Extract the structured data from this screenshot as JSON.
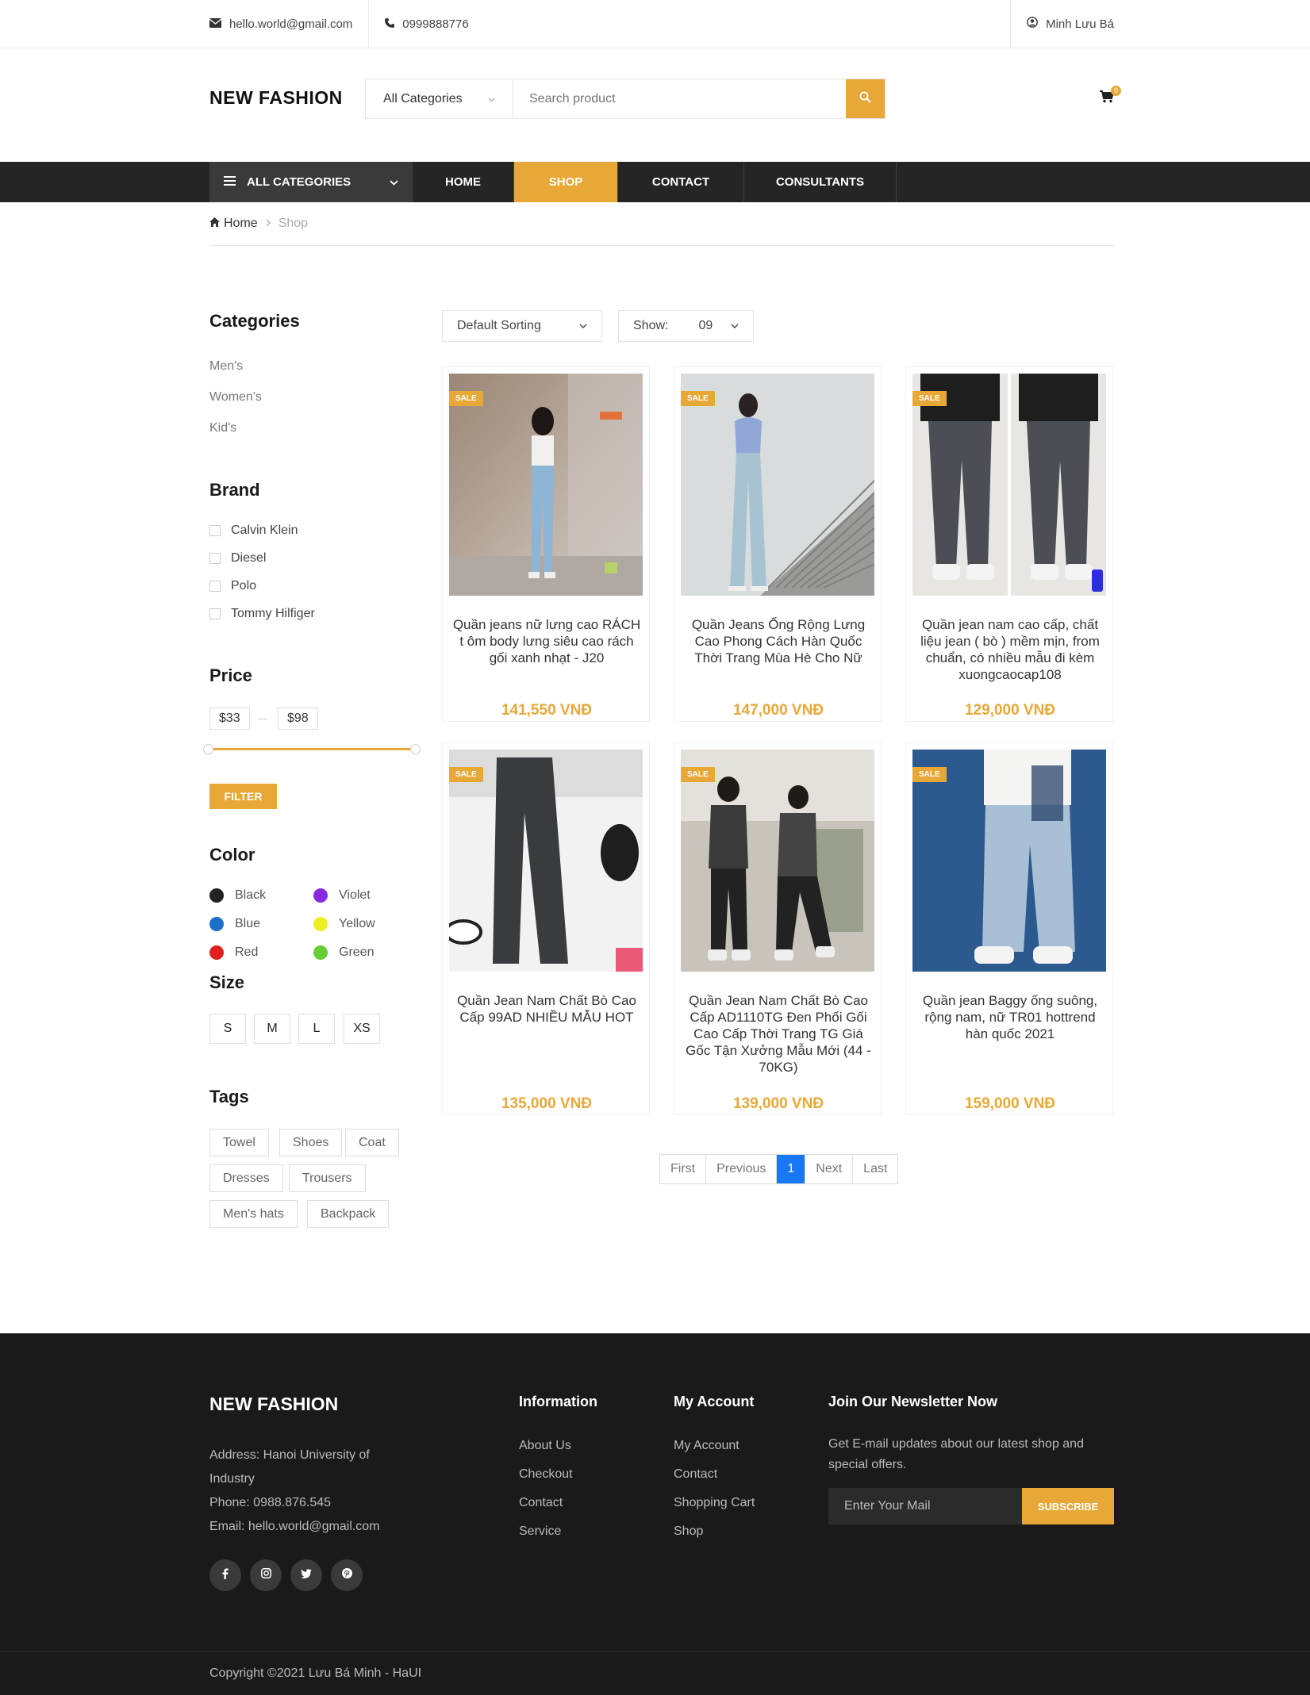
{
  "topbar": {
    "email": "hello.world@gmail.com",
    "phone": "0999888776",
    "user": "Minh Lưu Bá"
  },
  "header": {
    "logo": "NEW FASHION",
    "category_select": "All Categories",
    "search_placeholder": "Search product",
    "cart_count": "0"
  },
  "nav": {
    "all_categories": "ALL CATEGORIES",
    "items": [
      "HOME",
      "SHOP",
      "CONTACT",
      "CONSULTANTS"
    ],
    "active": "SHOP"
  },
  "breadcrumb": {
    "home": "Home",
    "current": "Shop"
  },
  "sidebar": {
    "categories_title": "Categories",
    "categories": [
      "Men's",
      "Women's",
      "Kid's"
    ],
    "brand_title": "Brand",
    "brands": [
      "Calvin Klein",
      "Diesel",
      "Polo",
      "Tommy Hilfiger"
    ],
    "price_title": "Price",
    "price_min": "$33",
    "price_max": "$98",
    "filter_label": "FILTER",
    "color_title": "Color",
    "colors": [
      {
        "name": "Black",
        "hex": "#222222"
      },
      {
        "name": "Violet",
        "hex": "#8a2be2"
      },
      {
        "name": "Blue",
        "hex": "#1e6fc9"
      },
      {
        "name": "Yellow",
        "hex": "#f0f020"
      },
      {
        "name": "Red",
        "hex": "#e02020"
      },
      {
        "name": "Green",
        "hex": "#66cc33"
      }
    ],
    "size_title": "Size",
    "sizes": [
      "S",
      "M",
      "L",
      "XS"
    ],
    "tags_title": "Tags",
    "tags": [
      "Towel",
      "Shoes",
      "Coat",
      "Dresses",
      "Trousers",
      "Men's hats",
      "Backpack"
    ]
  },
  "toolbar": {
    "sorting": "Default Sorting",
    "show_label": "Show:",
    "show_value": "09"
  },
  "products": [
    {
      "title": "Quần jeans nữ lưng cao RÁCH t ôm body lưng siêu cao rách gối xanh nhạt - J20",
      "price": "141,550 VNĐ",
      "badge": "SALE"
    },
    {
      "title": "Quần Jeans Ống Rộng Lưng Cao Phong Cách Hàn Quốc Thời Trang Mùa Hè Cho Nữ",
      "price": "147,000 VNĐ",
      "badge": "SALE"
    },
    {
      "title": "Quần jean nam cao cấp, chất liệu jean ( bò ) mềm mịn, from chuẩn, có nhiều mẫu đi kèm xuongcaocap108",
      "price": "129,000 VNĐ",
      "badge": "SALE"
    },
    {
      "title": "Quần Jean Nam Chất Bò Cao Cấp 99AD NHIỀU MẪU HOT",
      "price": "135,000 VNĐ",
      "badge": "SALE"
    },
    {
      "title": "Quần Jean Nam Chất Bò Cao Cấp AD1110TG Đen Phối Gối Cao Cấp Thời Trang TG Giá Gốc Tận Xưởng Mẫu Mới (44 - 70KG)",
      "price": "139,000 VNĐ",
      "badge": "SALE"
    },
    {
      "title": "Quần jean Baggy ống suông, rộng nam, nữ TR01 hottrend hàn quốc 2021",
      "price": "159,000 VNĐ",
      "badge": "SALE"
    }
  ],
  "pagination": [
    "First",
    "Previous",
    "1",
    "Next",
    "Last"
  ],
  "footer": {
    "logo": "NEW FASHION",
    "address": "Address: Hanoi University of",
    "address2": "Industry",
    "phone": "Phone: 0988.876.545",
    "email": "Email: hello.world@gmail.com",
    "info_title": "Information",
    "info_links": [
      "About Us",
      "Checkout",
      "Contact",
      "Service"
    ],
    "account_title": "My Account",
    "account_links": [
      "My Account",
      "Contact",
      "Shopping Cart",
      "Shop"
    ],
    "newsletter_title": "Join Our Newsletter Now",
    "newsletter_text1": "Get E-mail updates about our latest shop and",
    "newsletter_text2": "special offers.",
    "newsletter_placeholder": "Enter Your Mail",
    "subscribe_label": "SUBSCRIBE",
    "copyright": "Copyright ©2021 Lưu Bá Minh - HaUI"
  },
  "theme": {
    "accent": "#e8a838",
    "dark": "#252525",
    "footer_bg": "#1a1a1a",
    "page_active": "#1877f2"
  }
}
